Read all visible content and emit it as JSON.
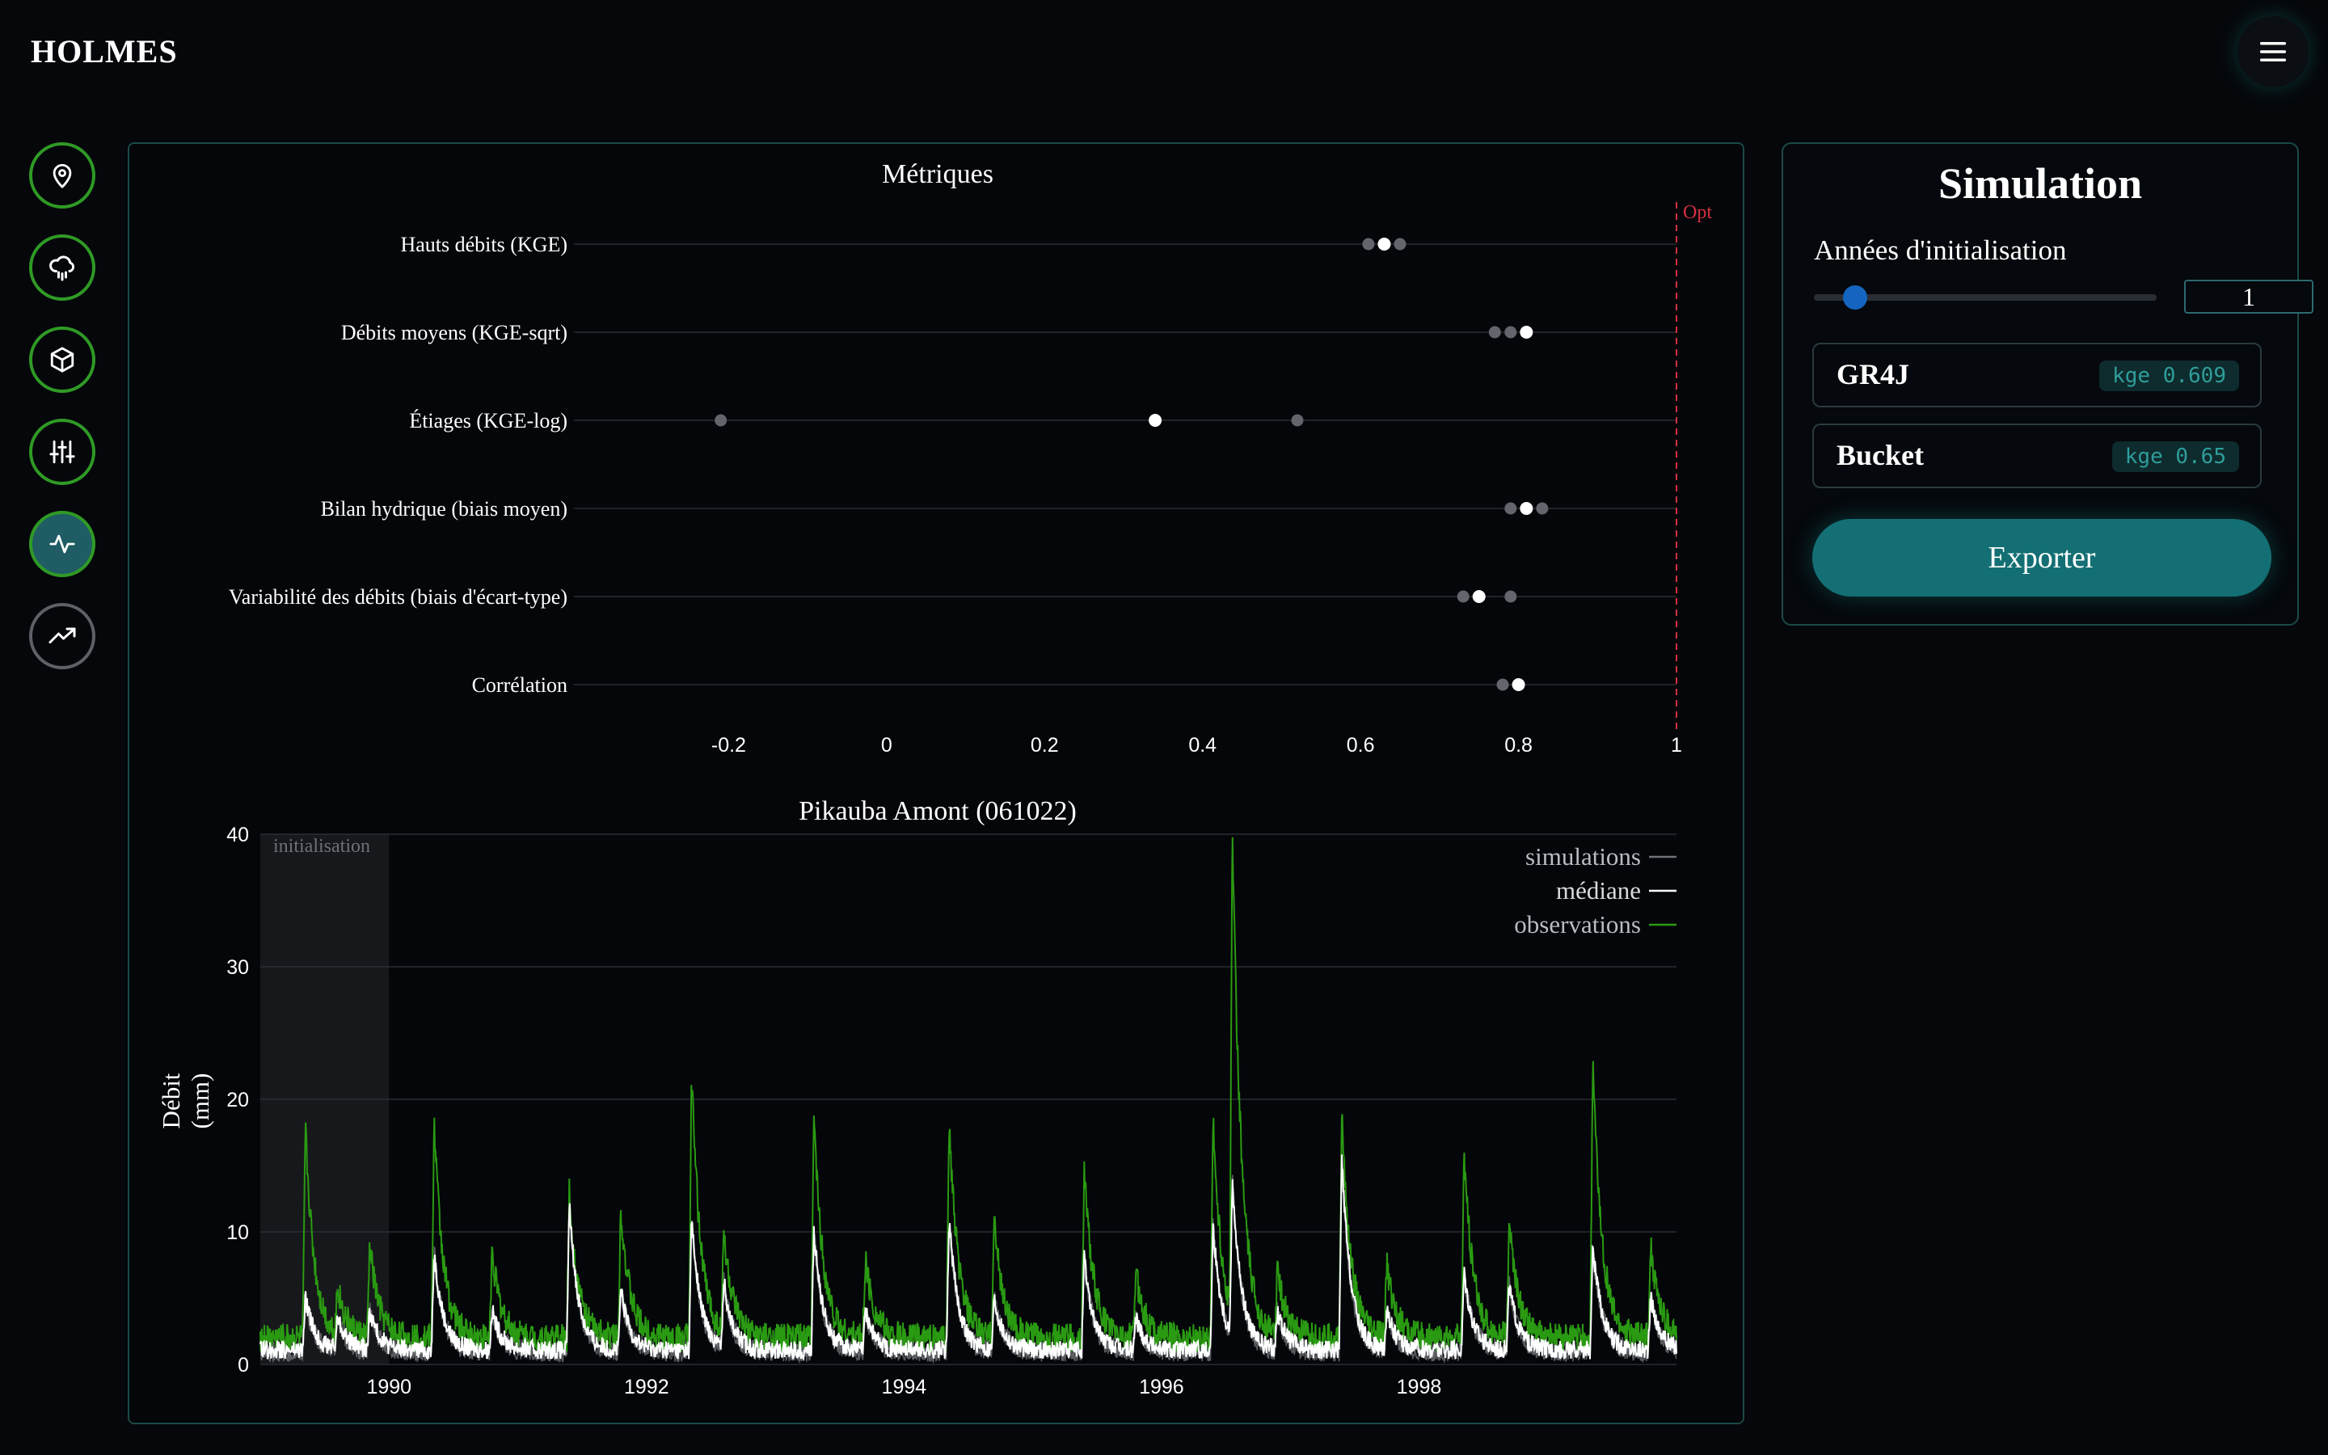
{
  "app": {
    "brand": "HOLMES"
  },
  "icons": {
    "menu": "hamburger-icon",
    "nav": [
      "map-pin-icon",
      "cloud-rain-icon",
      "cube-icon",
      "sliders-icon",
      "activity-icon",
      "trending-up-icon"
    ]
  },
  "colors": {
    "accent": "#136f73",
    "nav_border": "#2f9a25",
    "nav_active_bg": "#1f5c63",
    "opt_line": "#d33040",
    "observations": "#2a9a12",
    "median": "#ffffff",
    "simulations": "#6f7378"
  },
  "simulation": {
    "title": "Simulation",
    "init_label": "Années d'initialisation",
    "init_value": "1",
    "slider_fraction": 0.12,
    "models": [
      {
        "name": "GR4J",
        "kge": "kge 0.609"
      },
      {
        "name": "Bucket",
        "kge": "kge 0.65"
      }
    ],
    "export_label": "Exporter"
  },
  "chart_data": [
    {
      "type": "scatter",
      "title": "Métriques",
      "opt_label": "Opt",
      "categories": [
        "Hauts débits (KGE)",
        "Débits moyens (KGE-sqrt)",
        "Étiages (KGE-log)",
        "Bilan hydrique (biais moyen)",
        "Variabilité des débits (biais d'écart-type)",
        "Corrélation"
      ],
      "median": [
        0.63,
        0.81,
        0.34,
        0.81,
        0.75,
        0.8
      ],
      "simulations": [
        [
          0.61,
          0.65
        ],
        [
          0.77,
          0.79
        ],
        [
          -0.21,
          0.52
        ],
        [
          0.79,
          0.83
        ],
        [
          0.73,
          0.79
        ],
        [
          0.78
        ]
      ],
      "xlim": [
        -0.4,
        1.0
      ],
      "xticks": [
        -0.2,
        0,
        0.2,
        0.4,
        0.6,
        0.8,
        1
      ],
      "optimum": 1,
      "grid": true
    },
    {
      "type": "line",
      "title": "Pikauba Amont (061022)",
      "ylabel": "Débit (mm)",
      "xlabel": "",
      "ylim": [
        0,
        40
      ],
      "yticks": [
        0,
        10,
        20,
        30,
        40
      ],
      "xlim": [
        1989,
        2000
      ],
      "xticks": [
        1990,
        1992,
        1994,
        1996,
        1998
      ],
      "shaded_label": "initialisation",
      "shaded_range": [
        1989,
        1990
      ],
      "legend": [
        "simulations",
        "médiane",
        "observations"
      ],
      "legend_position": "top-right",
      "grid": true,
      "peaks": [
        {
          "x": 1989.35,
          "obs": 16,
          "med": 4
        },
        {
          "x": 1989.6,
          "obs": 3.5,
          "med": 2.5
        },
        {
          "x": 1989.85,
          "obs": 7,
          "med": 3
        },
        {
          "x": 1990.35,
          "obs": 16.5,
          "med": 7.5
        },
        {
          "x": 1990.8,
          "obs": 6.5,
          "med": 3
        },
        {
          "x": 1991.4,
          "obs": 11,
          "med": 11
        },
        {
          "x": 1991.8,
          "obs": 10,
          "med": 4.5
        },
        {
          "x": 1992.35,
          "obs": 20,
          "med": 10
        },
        {
          "x": 1992.6,
          "obs": 7.5,
          "med": 5
        },
        {
          "x": 1993.3,
          "obs": 17,
          "med": 9
        },
        {
          "x": 1993.7,
          "obs": 6,
          "med": 3
        },
        {
          "x": 1994.35,
          "obs": 16.5,
          "med": 10
        },
        {
          "x": 1994.7,
          "obs": 9,
          "med": 4
        },
        {
          "x": 1995.4,
          "obs": 13,
          "med": 7
        },
        {
          "x": 1995.8,
          "obs": 5,
          "med": 2.5
        },
        {
          "x": 1996.4,
          "obs": 16.5,
          "med": 9.5
        },
        {
          "x": 1996.55,
          "obs": 37,
          "med": 12
        },
        {
          "x": 1996.9,
          "obs": 5,
          "med": 3
        },
        {
          "x": 1997.4,
          "obs": 17,
          "med": 14.5
        },
        {
          "x": 1997.75,
          "obs": 5.5,
          "med": 3
        },
        {
          "x": 1998.35,
          "obs": 14,
          "med": 6
        },
        {
          "x": 1998.7,
          "obs": 9,
          "med": 5
        },
        {
          "x": 1999.35,
          "obs": 21,
          "med": 8
        },
        {
          "x": 1999.8,
          "obs": 7,
          "med": 4
        }
      ]
    }
  ]
}
